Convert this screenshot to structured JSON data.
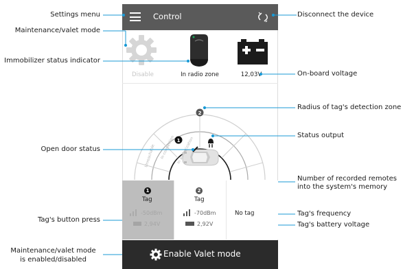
{
  "app": {
    "title": "Control"
  },
  "status": {
    "maintenance_label": "Disable",
    "immobilizer_label": "In radio zone",
    "voltage_label": "12,03V"
  },
  "radar": {
    "zone_labels": [
      "Unreachable",
      "In connection",
      "In authorization"
    ]
  },
  "tags": [
    {
      "num": "1",
      "label": "Tag",
      "frequency": "-50dBm",
      "battery": "2,94V"
    },
    {
      "num": "2",
      "label": "Tag",
      "frequency": "-70dBm",
      "battery": "2,92V"
    },
    {
      "label": "No tag"
    }
  ],
  "bottom": {
    "button_label": "Enable Valet mode"
  },
  "annotations": {
    "settings_menu": "Settings menu",
    "maintenance_mode": "Maintenance/valet mode",
    "immobilizer_indicator": "Immobilizer status indicator",
    "open_door": "Open door status",
    "button_press": "Tag's button press",
    "maintenance_toggle_line1": "Maintenance/valet mode",
    "maintenance_toggle_line2": "is enabled/disabled",
    "disconnect": "Disconnect the device",
    "onboard_voltage": "On-board voltage",
    "detection_radius": "Radius of tag's detection zone",
    "status_output": "Status output",
    "remotes_line1": "Number of recorded remotes",
    "remotes_line2": "into the system's memory",
    "tag_frequency": "Tag's frequency",
    "tag_battery": "Tag's battery voltage"
  },
  "colors": {
    "accent": "#1a9ad6",
    "topbar": "#5a5a5a",
    "bottombar": "#2b2b2b",
    "selected_tag": "#bdbdbd"
  }
}
